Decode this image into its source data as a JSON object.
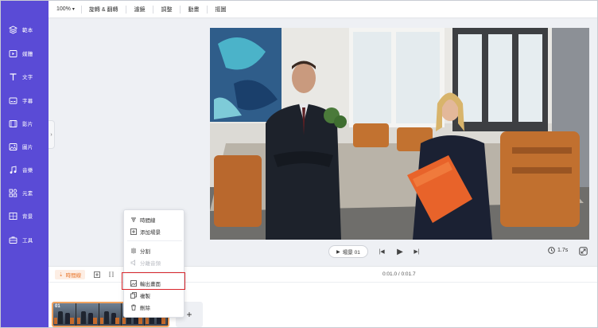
{
  "sidebar": {
    "items": [
      {
        "label": "範本",
        "icon": "template-icon"
      },
      {
        "label": "媒體",
        "icon": "media-icon"
      },
      {
        "label": "文字",
        "icon": "text-icon"
      },
      {
        "label": "字幕",
        "icon": "subtitle-icon"
      },
      {
        "label": "影片",
        "icon": "video-icon"
      },
      {
        "label": "圖片",
        "icon": "image-icon"
      },
      {
        "label": "音樂",
        "icon": "music-icon"
      },
      {
        "label": "元素",
        "icon": "elements-icon"
      },
      {
        "label": "背景",
        "icon": "background-icon"
      },
      {
        "label": "工具",
        "icon": "tools-icon"
      }
    ],
    "accent": "#5a4bd6"
  },
  "toolbar": {
    "zoom": "100%",
    "items": [
      "旋轉 & 翻轉",
      "濾鏡",
      "調整",
      "動畫",
      "摳圖"
    ]
  },
  "player": {
    "scene_label": "場景 01",
    "duration": "1.7s"
  },
  "timeline": {
    "badge": "時間線",
    "time_readout": "0:01.0 / 0:01.7",
    "clip_number": "01",
    "add_label": "+"
  },
  "context_menu": {
    "items": [
      {
        "label": "時間線",
        "icon": "timeline-icon",
        "disabled": false
      },
      {
        "label": "添加場景",
        "icon": "add-scene-icon",
        "disabled": false
      },
      {
        "label": "分割",
        "icon": "split-icon",
        "disabled": false
      },
      {
        "label": "分離音頻",
        "icon": "detach-audio-icon",
        "disabled": true
      },
      {
        "label": "輸出畫面",
        "icon": "export-frame-icon",
        "disabled": false,
        "highlighted": true
      },
      {
        "label": "複製",
        "icon": "duplicate-icon",
        "disabled": false
      },
      {
        "label": "刪除",
        "icon": "delete-icon",
        "disabled": false
      }
    ]
  },
  "colors": {
    "timeline_accent": "#e9782d",
    "highlight_box": "#d9252b"
  }
}
